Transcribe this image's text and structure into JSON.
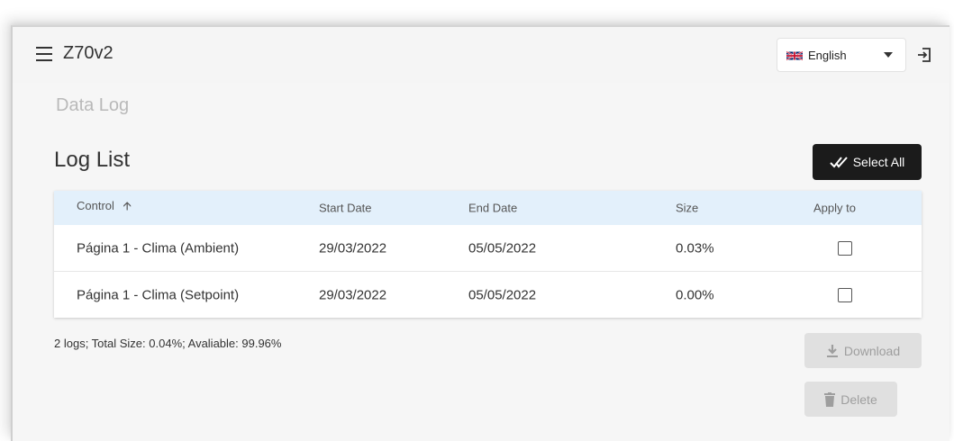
{
  "app": {
    "title": "Z70v2"
  },
  "language": {
    "selected": "English"
  },
  "page": {
    "section_title": "Data Log",
    "list_title": "Log List"
  },
  "actions": {
    "select_all": "Select All",
    "download": "Download",
    "delete": "Delete"
  },
  "table": {
    "headers": [
      "Control",
      "Start Date",
      "End Date",
      "Size",
      "Apply to"
    ],
    "sort": {
      "column": "Control",
      "direction": "ascending"
    },
    "rows": [
      {
        "control": "Página 1 - Clima (Ambient)",
        "start_date": "29/03/2022",
        "end_date": "05/05/2022",
        "size": "0.03%",
        "apply_to": false
      },
      {
        "control": "Página 1 - Clima (Setpoint)",
        "start_date": "29/03/2022",
        "end_date": "05/05/2022",
        "size": "0.00%",
        "apply_to": false
      }
    ]
  },
  "summary": "2 logs; Total Size: 0.04%; Avaliable: 99.96%",
  "colors": {
    "primary_button": "#1b1b1b",
    "table_header": "#e3f0fb",
    "disabled_button": "#e0e0e0"
  },
  "icons": [
    "menu-icon",
    "uk-flag-icon",
    "logout-icon",
    "sort-arrow-up-icon",
    "double-check-icon",
    "download-icon",
    "trash-icon"
  ]
}
